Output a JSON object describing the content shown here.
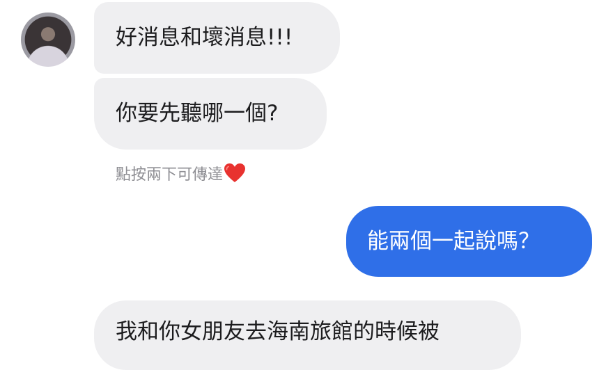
{
  "conversation": {
    "messages": [
      {
        "sender": "friend",
        "text": "好消息和壞消息!!!"
      },
      {
        "sender": "friend",
        "text": "你要先聽哪一個?"
      },
      {
        "sender": "me",
        "text": "能兩個一起說嗎？"
      },
      {
        "sender": "friend",
        "text": "我和你女朋友去海南旅館的時候被"
      }
    ],
    "reaction_hint": {
      "text": "點按兩下可傳達",
      "icon": "heart-icon",
      "icon_color": "#e8322f"
    }
  },
  "colors": {
    "incoming_bubble": "#efeff1",
    "outgoing_bubble": "#2f6fe8"
  }
}
